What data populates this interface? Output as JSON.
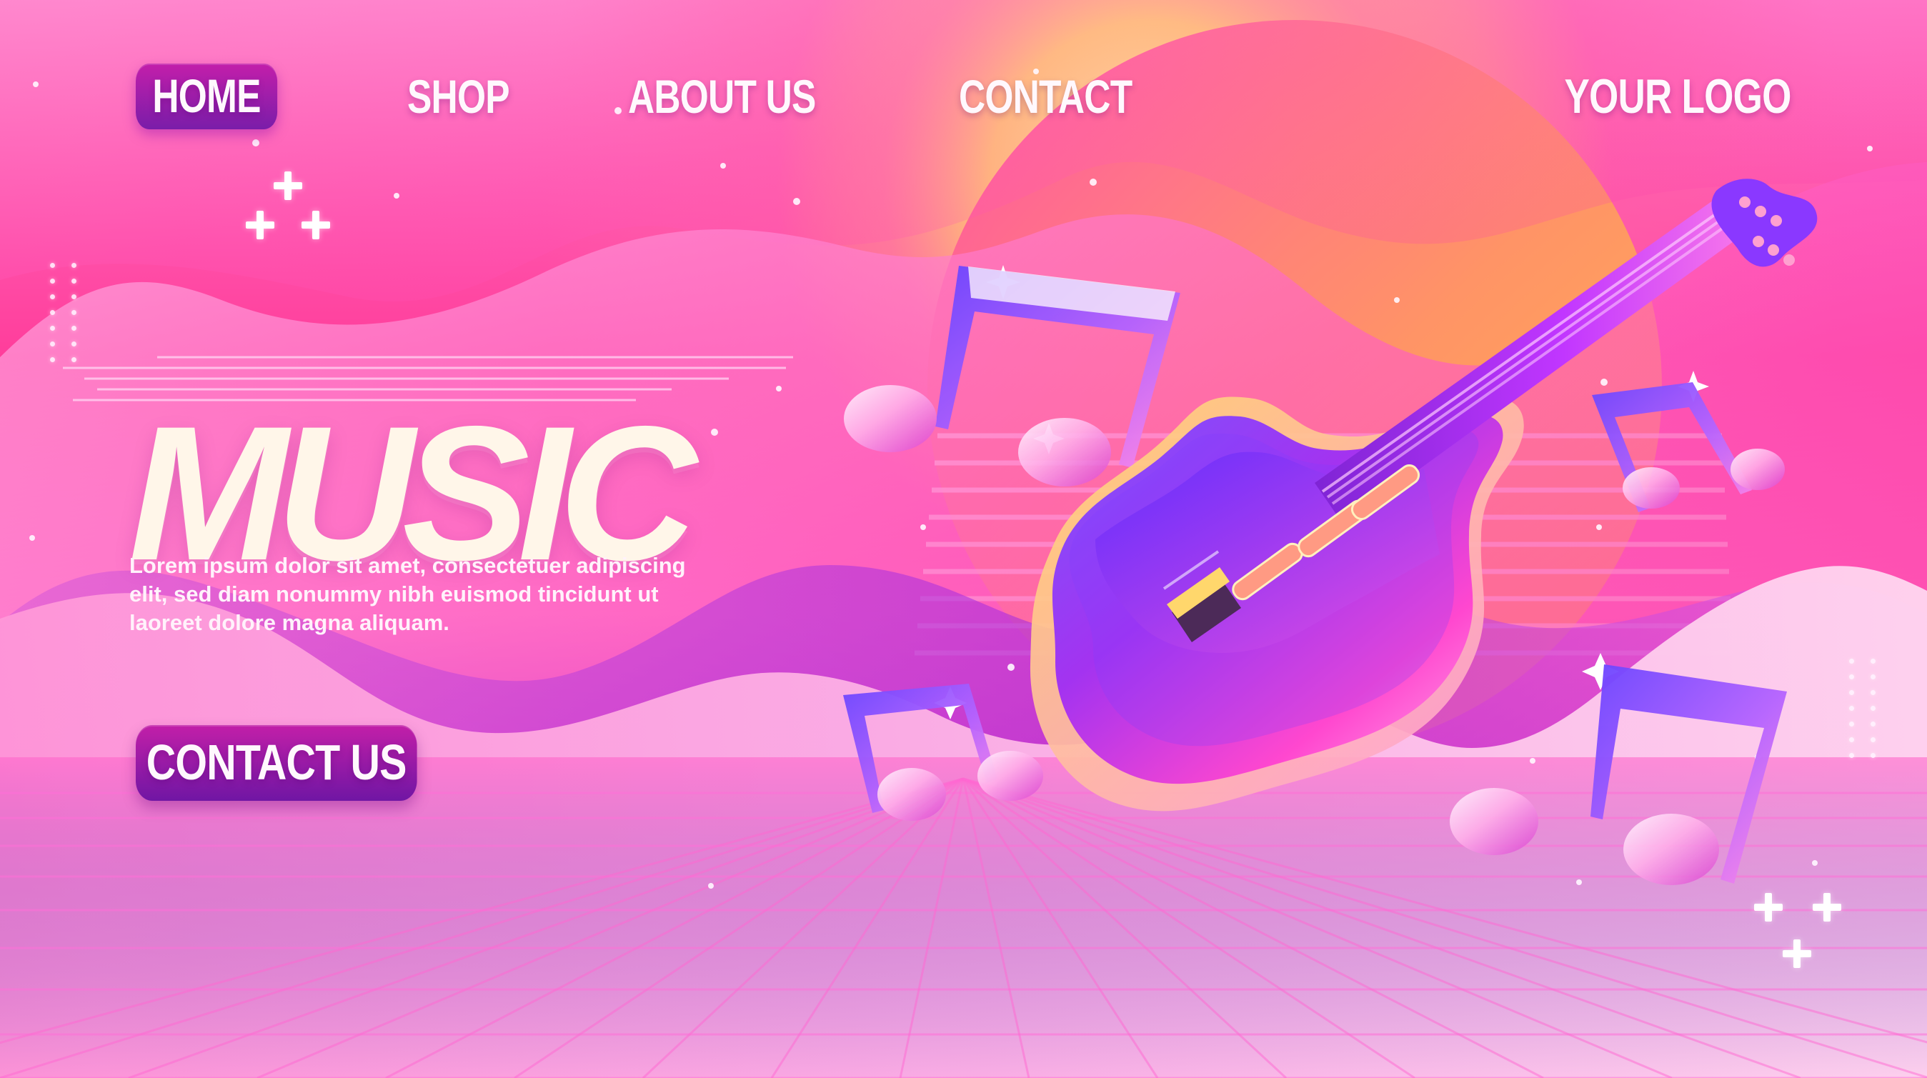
{
  "nav": {
    "items": [
      {
        "label": "HOME",
        "active": true
      },
      {
        "label": "SHOP",
        "active": false
      },
      {
        "label": "ABOUT US",
        "active": false
      },
      {
        "label": "CONTACT",
        "active": false
      }
    ],
    "logo": "YOUR LOGO"
  },
  "hero": {
    "title": "MUSIC",
    "body_lines": [
      "Lorem ipsum dolor sit amet, consectetuer adipiscing",
      "elit, sed diam nonummy nibh euismod tincidunt ut",
      "laoreet dolore magna aliquam."
    ],
    "button_label": "CONTACT US"
  },
  "decor": {
    "icon_names": [
      "plus-cluster-icon",
      "music-note-icon",
      "electric-guitar-icon"
    ],
    "colors": {
      "pink": "#ff3d9b",
      "purple": "#7a1fb8",
      "blue": "#3818ad",
      "gold": "#ffd85f",
      "white": "#fff8fd"
    }
  }
}
